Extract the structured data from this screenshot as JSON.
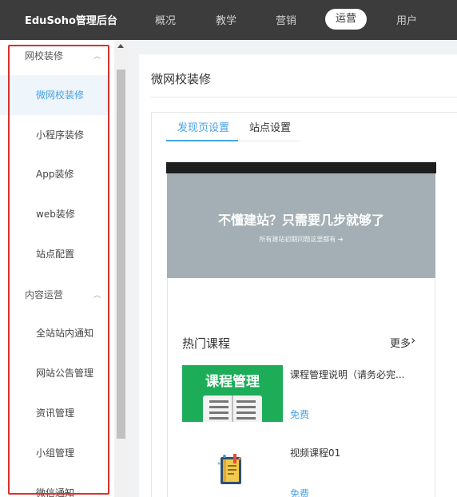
{
  "header": {
    "brand": "EduSoho管理后台",
    "nav": [
      {
        "label": "概况",
        "active": false
      },
      {
        "label": "教学",
        "active": false
      },
      {
        "label": "营销",
        "active": false
      },
      {
        "label": "运营",
        "active": true
      },
      {
        "label": "用户",
        "active": false
      }
    ]
  },
  "sidebar": {
    "groups": [
      {
        "label": "网校装修",
        "items": [
          {
            "label": "微网校装修",
            "active": true
          },
          {
            "label": "小程序装修",
            "active": false
          },
          {
            "label": "App装修",
            "active": false
          },
          {
            "label": "web装修",
            "active": false
          },
          {
            "label": "站点配置",
            "active": false
          }
        ]
      },
      {
        "label": "内容运营",
        "items": [
          {
            "label": "全站站内通知",
            "active": false
          },
          {
            "label": "网站公告管理",
            "active": false
          },
          {
            "label": "资讯管理",
            "active": false
          },
          {
            "label": "小组管理",
            "active": false
          },
          {
            "label": "微信通知",
            "active": false
          }
        ]
      }
    ],
    "caret_icon": "chevron-up-icon",
    "highlight_color": "#d9302d"
  },
  "main": {
    "title": "微网校装修",
    "tabs": [
      {
        "label": "发现页设置",
        "active": true
      },
      {
        "label": "站点设置",
        "active": false
      }
    ],
    "preview": {
      "banner": {
        "title": "不懂建站？只需要几步就够了",
        "subtitle": "所有建站初期问题这里都有 ➜"
      },
      "section": {
        "title": "热门课程",
        "more_label": "更多",
        "more_icon": "chevron-right-icon"
      },
      "courses": [
        {
          "thumb_text": "课程管理",
          "name": "课程管理说明（请务必完...",
          "price": "免费"
        },
        {
          "name": "视频课程01",
          "price": "免费",
          "icon": "book-icon"
        }
      ]
    }
  },
  "colors": {
    "topbar": "#3c3c3c",
    "accent": "#46a3e5",
    "banner": "#a3afb4",
    "thumb": "#1dad59"
  }
}
